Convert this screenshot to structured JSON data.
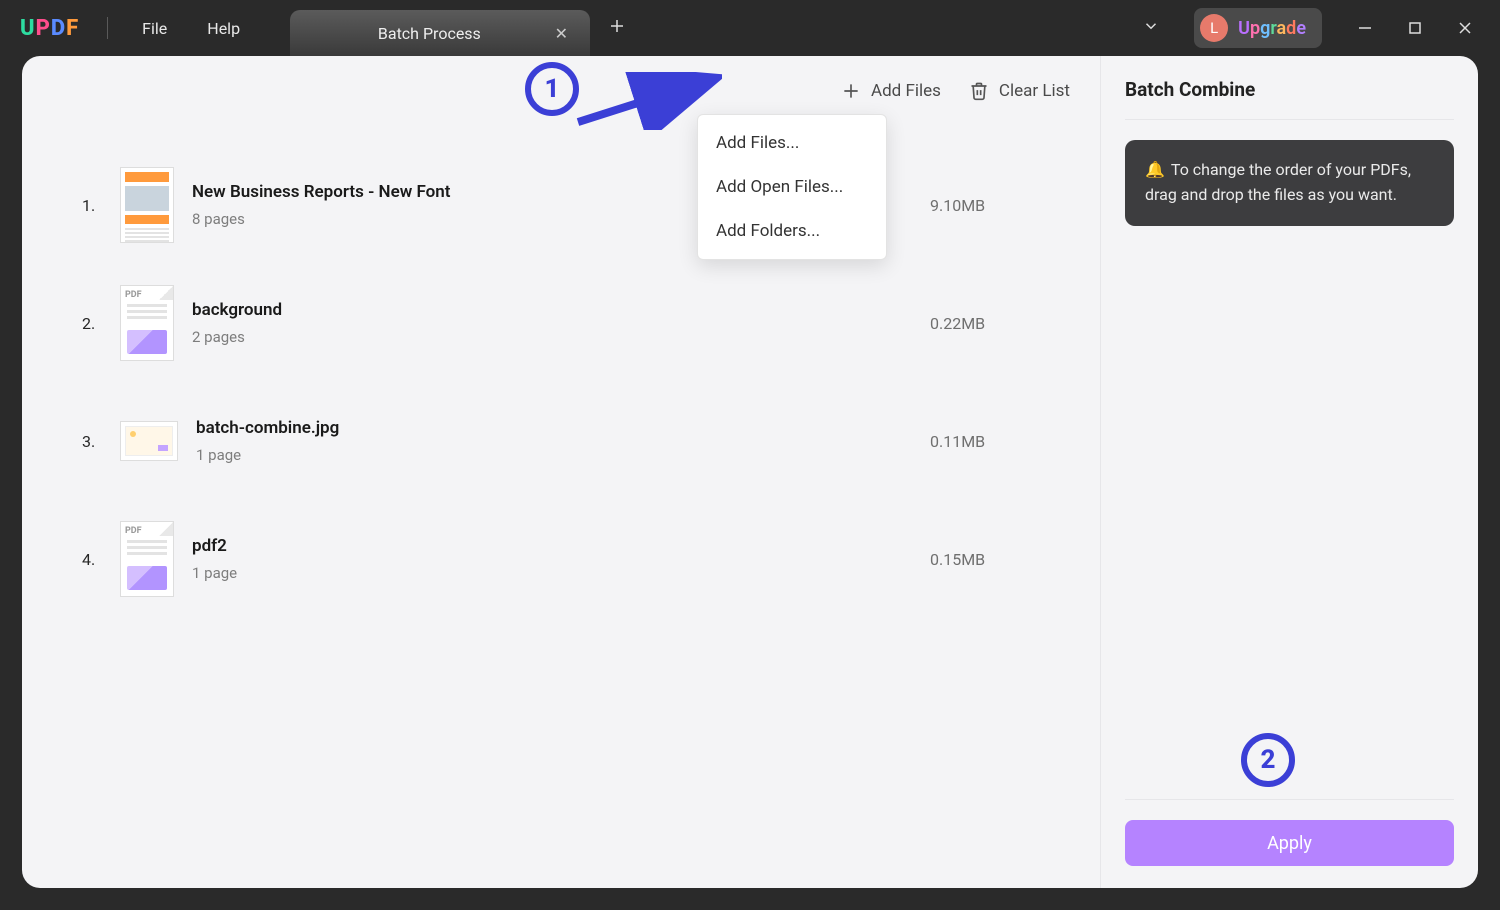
{
  "titlebar": {
    "logo_letters": [
      "U",
      "P",
      "D",
      "F"
    ],
    "menu": {
      "file": "File",
      "help": "Help"
    },
    "tab": {
      "title": "Batch Process"
    },
    "upgrade": {
      "avatar_letter": "L",
      "text": "Upgrade"
    }
  },
  "toolbar": {
    "add_files": "Add Files",
    "clear_list": "Clear List"
  },
  "dropdown": {
    "items": [
      "Add Files...",
      "Add Open Files...",
      "Add Folders..."
    ]
  },
  "files": [
    {
      "num": "1.",
      "name": "New Business Reports - New Font",
      "pages": "8 pages",
      "size": "9.10MB",
      "thumb": "report"
    },
    {
      "num": "2.",
      "name": "background",
      "pages": "2 pages",
      "size": "0.22MB",
      "thumb": "pdf"
    },
    {
      "num": "3.",
      "name": "batch-combine.jpg",
      "pages": "1 page",
      "size": "0.11MB",
      "thumb": "wide"
    },
    {
      "num": "4.",
      "name": "pdf2",
      "pages": "1 page",
      "size": "0.15MB",
      "thumb": "pdf"
    }
  ],
  "side": {
    "title": "Batch Combine",
    "tip": "To change the order of your PDFs, drag and drop the files as you want.",
    "apply": "Apply"
  },
  "annotations": {
    "one": "1",
    "two": "2"
  }
}
